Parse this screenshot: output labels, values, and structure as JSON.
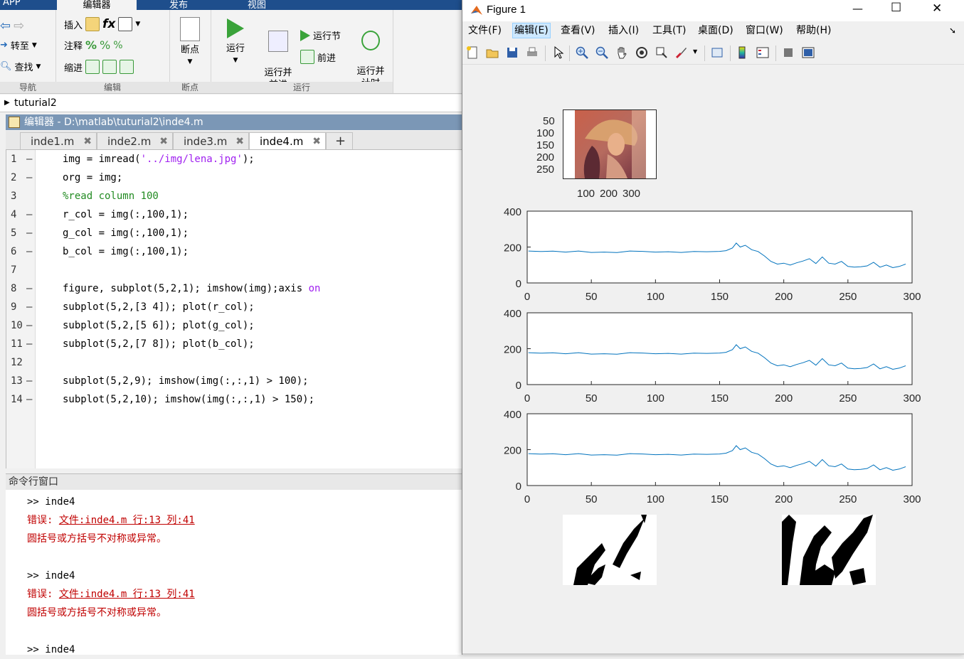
{
  "ribbon": {
    "tabs": [
      "APP",
      "编辑器",
      "发布",
      "视图"
    ],
    "nav": {
      "insert": "插入",
      "goto": "转至",
      "comment": "注释",
      "find": "查找",
      "indent": "缩进",
      "footer_nav": "导航",
      "footer_edit": "编辑"
    },
    "breakpoint": {
      "label": "断点",
      "footer": "断点"
    },
    "run": {
      "run": "运行",
      "run_advance": "运行并\n前进",
      "run_section": "运行节",
      "advance": "前进",
      "run_time": "运行并\n计时",
      "footer": "运行"
    }
  },
  "address": {
    "path": "tuturial2"
  },
  "editor": {
    "title": "编辑器 - D:\\matlab\\tuturial2\\inde4.m",
    "tabs": [
      {
        "label": "inde1.m",
        "close": "✖"
      },
      {
        "label": "inde2.m",
        "close": "✖"
      },
      {
        "label": "inde3.m",
        "close": "✖"
      },
      {
        "label": "inde4.m",
        "close": "✖"
      }
    ],
    "add_tab": "+",
    "lines": [
      {
        "n": "1",
        "dash": "—",
        "parts": [
          {
            "t": "img = imread(",
            "c": ""
          },
          {
            "t": "'../img/lena.jpg'",
            "c": "str"
          },
          {
            "t": ");",
            "c": ""
          }
        ]
      },
      {
        "n": "2",
        "dash": "—",
        "parts": [
          {
            "t": "org = img;",
            "c": ""
          }
        ]
      },
      {
        "n": "3",
        "dash": "",
        "parts": [
          {
            "t": "%read column 100",
            "c": "cmt"
          }
        ]
      },
      {
        "n": "4",
        "dash": "—",
        "parts": [
          {
            "t": "r_col = img(:,100,1);",
            "c": ""
          }
        ]
      },
      {
        "n": "5",
        "dash": "—",
        "parts": [
          {
            "t": "g_col = img(:,100,1);",
            "c": ""
          }
        ]
      },
      {
        "n": "6",
        "dash": "—",
        "parts": [
          {
            "t": "b_col = img(:,100,1);",
            "c": ""
          }
        ]
      },
      {
        "n": "7",
        "dash": "",
        "parts": []
      },
      {
        "n": "8",
        "dash": "—",
        "parts": [
          {
            "t": "figure, subplot(5,2,1); imshow(img);axis ",
            "c": ""
          },
          {
            "t": "on",
            "c": "kw"
          }
        ]
      },
      {
        "n": "9",
        "dash": "—",
        "parts": [
          {
            "t": "subplot(5,2,[3 4]); plot(r_col);",
            "c": ""
          }
        ]
      },
      {
        "n": "10",
        "dash": "—",
        "parts": [
          {
            "t": "subplot(5,2,[5 6]); plot(g_col);",
            "c": ""
          }
        ]
      },
      {
        "n": "11",
        "dash": "—",
        "parts": [
          {
            "t": "subplot(5,2,[7 8]); plot(b_col);",
            "c": ""
          }
        ]
      },
      {
        "n": "12",
        "dash": "",
        "parts": []
      },
      {
        "n": "13",
        "dash": "—",
        "parts": [
          {
            "t": "subplot(5,2,9); imshow(img(:,:,1) > 100);",
            "c": ""
          }
        ]
      },
      {
        "n": "14",
        "dash": "—",
        "parts": [
          {
            "t": "subplot(5,2,10); imshow(img(:,:,1) > 150);",
            "c": ""
          }
        ]
      }
    ]
  },
  "command_window": {
    "title": "命令行窗口",
    "entries": [
      {
        "prompt": ">> inde4",
        "err_prefix": "错误: ",
        "err_link": "文件:inde4.m 行:13 列:41",
        "err_msg": "圆括号或方括号不对称或异常。"
      },
      {
        "prompt": ">> inde4",
        "err_prefix": "错误: ",
        "err_link": "文件:inde4.m 行:13 列:41",
        "err_msg": "圆括号或方括号不对称或异常。"
      },
      {
        "prompt": ">> inde4"
      }
    ]
  },
  "figure": {
    "title": "Figure 1",
    "window_controls": {
      "minimize": "—",
      "maximize": "☐",
      "close": "✕"
    },
    "menu": [
      "文件(F)",
      "编辑(E)",
      "查看(V)",
      "插入(I)",
      "工具(T)",
      "桌面(D)",
      "窗口(W)",
      "帮助(H)"
    ],
    "menu_selected": "编辑(E)",
    "dock_arrow": "➘",
    "image_axes": {
      "yticks": [
        "50",
        "100",
        "150",
        "200",
        "250"
      ],
      "xticks": [
        "100",
        "200",
        "300"
      ]
    },
    "colors": {
      "line": "#0072bd",
      "axes_bg": "#ffffff",
      "fig_bg": "#f0f0f0"
    }
  },
  "chart_data": [
    {
      "type": "line",
      "xlim": [
        0,
        300
      ],
      "ylim": [
        0,
        400
      ],
      "xticks": [
        0,
        50,
        100,
        150,
        200,
        250,
        300
      ],
      "yticks": [
        0,
        200,
        400
      ],
      "series": [
        {
          "x": [
            1,
            10,
            20,
            30,
            40,
            50,
            60,
            70,
            80,
            90,
            100,
            110,
            120,
            130,
            140,
            150,
            155,
            160,
            163,
            166,
            170,
            175,
            180,
            185,
            190,
            195,
            200,
            205,
            210,
            215,
            220,
            225,
            230,
            235,
            240,
            245,
            250,
            255,
            260,
            265,
            270,
            275,
            280,
            285,
            290,
            295
          ],
          "values": [
            178,
            175,
            177,
            172,
            178,
            170,
            172,
            169,
            178,
            176,
            172,
            174,
            170,
            175,
            174,
            176,
            180,
            195,
            222,
            200,
            210,
            185,
            175,
            150,
            120,
            105,
            110,
            100,
            112,
            122,
            135,
            108,
            145,
            110,
            105,
            120,
            92,
            88,
            90,
            95,
            115,
            88,
            100,
            85,
            92,
            105
          ]
        }
      ]
    },
    {
      "type": "line",
      "xlim": [
        0,
        300
      ],
      "ylim": [
        0,
        400
      ],
      "xticks": [
        0,
        50,
        100,
        150,
        200,
        250,
        300
      ],
      "yticks": [
        0,
        200,
        400
      ],
      "series": [
        {
          "x": [
            1,
            10,
            20,
            30,
            40,
            50,
            60,
            70,
            80,
            90,
            100,
            110,
            120,
            130,
            140,
            150,
            155,
            160,
            163,
            166,
            170,
            175,
            180,
            185,
            190,
            195,
            200,
            205,
            210,
            215,
            220,
            225,
            230,
            235,
            240,
            245,
            250,
            255,
            260,
            265,
            270,
            275,
            280,
            285,
            290,
            295
          ],
          "values": [
            178,
            175,
            177,
            172,
            178,
            170,
            172,
            169,
            178,
            176,
            172,
            174,
            170,
            175,
            174,
            176,
            180,
            195,
            222,
            200,
            210,
            185,
            175,
            150,
            120,
            105,
            110,
            100,
            112,
            122,
            135,
            108,
            145,
            110,
            105,
            120,
            92,
            88,
            90,
            95,
            115,
            88,
            100,
            85,
            92,
            105
          ]
        }
      ]
    },
    {
      "type": "line",
      "xlim": [
        0,
        300
      ],
      "ylim": [
        0,
        400
      ],
      "xticks": [
        0,
        50,
        100,
        150,
        200,
        250,
        300
      ],
      "yticks": [
        0,
        200,
        400
      ],
      "series": [
        {
          "x": [
            1,
            10,
            20,
            30,
            40,
            50,
            60,
            70,
            80,
            90,
            100,
            110,
            120,
            130,
            140,
            150,
            155,
            160,
            163,
            166,
            170,
            175,
            180,
            185,
            190,
            195,
            200,
            205,
            210,
            215,
            220,
            225,
            230,
            235,
            240,
            245,
            250,
            255,
            260,
            265,
            270,
            275,
            280,
            285,
            290,
            295
          ],
          "values": [
            178,
            175,
            177,
            172,
            178,
            170,
            172,
            169,
            178,
            176,
            172,
            174,
            170,
            175,
            174,
            176,
            180,
            195,
            222,
            200,
            210,
            185,
            175,
            150,
            120,
            105,
            110,
            100,
            112,
            122,
            135,
            108,
            145,
            110,
            105,
            120,
            92,
            88,
            90,
            95,
            115,
            88,
            100,
            85,
            92,
            105
          ]
        }
      ]
    }
  ]
}
